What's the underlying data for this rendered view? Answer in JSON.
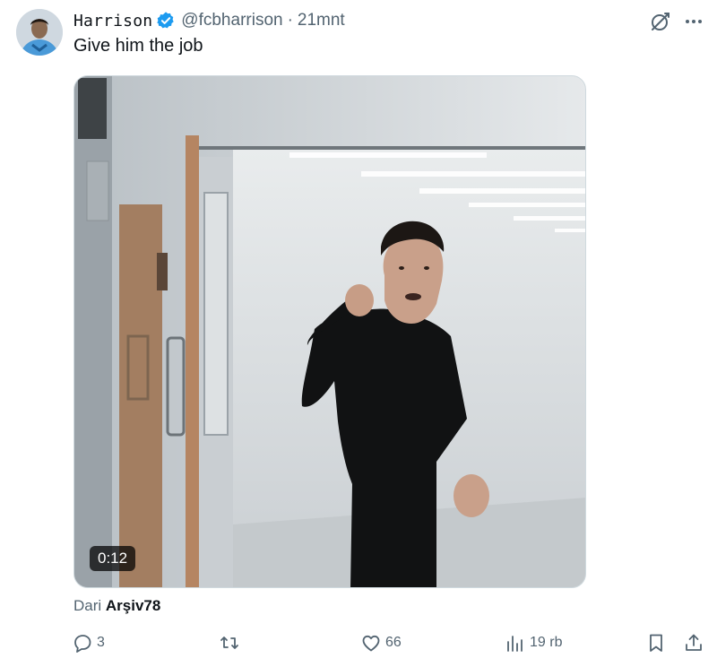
{
  "post": {
    "author_name": "Harrison",
    "handle": "@fcbharrison",
    "separator": "·",
    "time": "21mnt",
    "text": "Give him the job",
    "video_duration": "0:12",
    "source_prefix": "Dari",
    "source_name": "Arşiv78"
  },
  "actions": {
    "replies": "3",
    "likes": "66",
    "views": "19 rb"
  },
  "colors": {
    "verified": "#1d9bf0",
    "muted_text": "#536471",
    "primary_text": "#0f1419"
  },
  "icons": [
    "verified-badge-icon",
    "grok-icon",
    "more-icon",
    "reply-icon",
    "repost-icon",
    "like-icon",
    "views-icon",
    "bookmark-icon",
    "share-icon"
  ]
}
